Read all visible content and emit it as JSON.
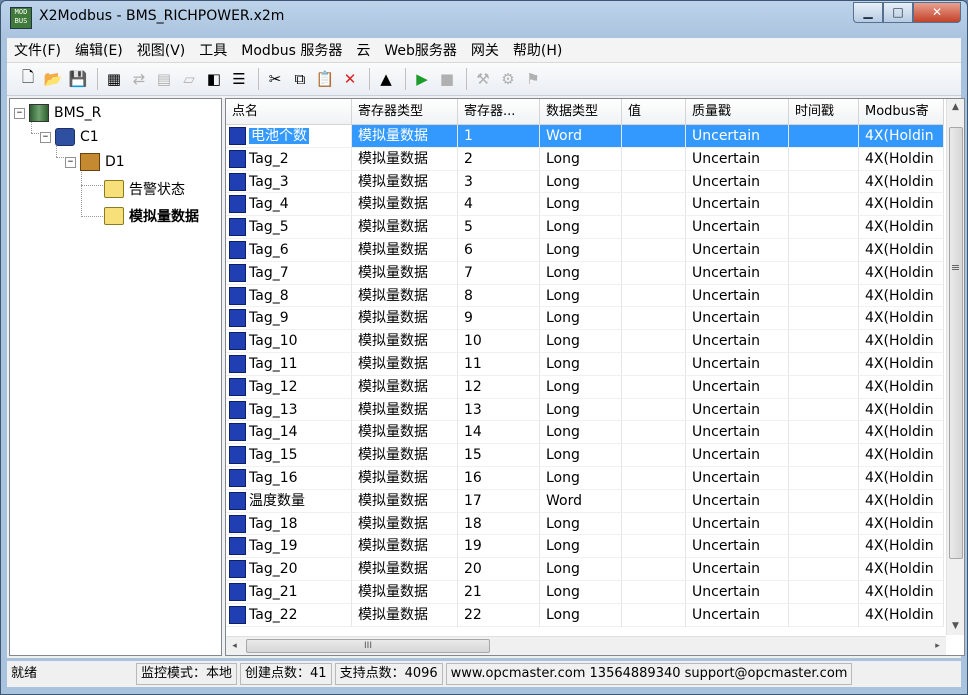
{
  "window": {
    "app_icon": "MOD BUS",
    "title": "X2Modbus - BMS_RICHPOWER.x2m",
    "buttons": {
      "minimize": "▁",
      "maximize": "□",
      "close": "✕"
    }
  },
  "menu": [
    "文件(F)",
    "编辑(E)",
    "视图(V)",
    "工具",
    "Modbus 服务器",
    "云",
    "Web服务器",
    "网关",
    "帮助(H)"
  ],
  "toolbar_icons": [
    {
      "name": "new-icon",
      "glyph": "🗋",
      "enabled": true
    },
    {
      "name": "open-icon",
      "glyph": "📂",
      "enabled": true
    },
    {
      "name": "save-icon",
      "glyph": "💾",
      "enabled": false
    },
    {
      "name": "add-server-icon",
      "glyph": "▦",
      "enabled": true
    },
    {
      "name": "add-channel-icon",
      "glyph": "⇄",
      "enabled": false
    },
    {
      "name": "add-device-icon",
      "glyph": "▤",
      "enabled": false
    },
    {
      "name": "add-group-icon",
      "glyph": "▱",
      "enabled": false
    },
    {
      "name": "add-tag-icon",
      "glyph": "◧",
      "enabled": true
    },
    {
      "name": "properties-icon",
      "glyph": "☰",
      "enabled": true
    },
    {
      "name": "cut-icon",
      "glyph": "✂",
      "enabled": true
    },
    {
      "name": "copy-icon",
      "glyph": "⧉",
      "enabled": true
    },
    {
      "name": "paste-icon",
      "glyph": "📋",
      "enabled": false
    },
    {
      "name": "delete-icon",
      "glyph": "✕",
      "enabled": true
    },
    {
      "name": "monitor-icon",
      "glyph": "▲",
      "enabled": true
    },
    {
      "name": "run-icon",
      "glyph": "▶",
      "enabled": true
    },
    {
      "name": "stop-icon",
      "glyph": "■",
      "enabled": false
    },
    {
      "name": "tool1-icon",
      "glyph": "⚒",
      "enabled": false
    },
    {
      "name": "tool2-icon",
      "glyph": "⚙",
      "enabled": false
    },
    {
      "name": "tool3-icon",
      "glyph": "⚑",
      "enabled": false
    }
  ],
  "tree": {
    "server": "BMS_R",
    "channel": "C1",
    "device": "D1",
    "groups": [
      "告警状态",
      "模拟量数据"
    ],
    "expand_glyph": "−"
  },
  "grid": {
    "columns": [
      "点名",
      "寄存器类型",
      "寄存器...",
      "数据类型",
      "值",
      "质量戳",
      "时间戳",
      "Modbus寄"
    ],
    "rows": [
      {
        "name": "电池个数",
        "reg_type": "模拟量数据",
        "reg": "1",
        "dtype": "Word",
        "value": "",
        "quality": "Uncertain",
        "time": "",
        "modbus": "4X(Holdin"
      },
      {
        "name": "Tag_2",
        "reg_type": "模拟量数据",
        "reg": "2",
        "dtype": "Long",
        "value": "",
        "quality": "Uncertain",
        "time": "",
        "modbus": "4X(Holdin"
      },
      {
        "name": "Tag_3",
        "reg_type": "模拟量数据",
        "reg": "3",
        "dtype": "Long",
        "value": "",
        "quality": "Uncertain",
        "time": "",
        "modbus": "4X(Holdin"
      },
      {
        "name": "Tag_4",
        "reg_type": "模拟量数据",
        "reg": "4",
        "dtype": "Long",
        "value": "",
        "quality": "Uncertain",
        "time": "",
        "modbus": "4X(Holdin"
      },
      {
        "name": "Tag_5",
        "reg_type": "模拟量数据",
        "reg": "5",
        "dtype": "Long",
        "value": "",
        "quality": "Uncertain",
        "time": "",
        "modbus": "4X(Holdin"
      },
      {
        "name": "Tag_6",
        "reg_type": "模拟量数据",
        "reg": "6",
        "dtype": "Long",
        "value": "",
        "quality": "Uncertain",
        "time": "",
        "modbus": "4X(Holdin"
      },
      {
        "name": "Tag_7",
        "reg_type": "模拟量数据",
        "reg": "7",
        "dtype": "Long",
        "value": "",
        "quality": "Uncertain",
        "time": "",
        "modbus": "4X(Holdin"
      },
      {
        "name": "Tag_8",
        "reg_type": "模拟量数据",
        "reg": "8",
        "dtype": "Long",
        "value": "",
        "quality": "Uncertain",
        "time": "",
        "modbus": "4X(Holdin"
      },
      {
        "name": "Tag_9",
        "reg_type": "模拟量数据",
        "reg": "9",
        "dtype": "Long",
        "value": "",
        "quality": "Uncertain",
        "time": "",
        "modbus": "4X(Holdin"
      },
      {
        "name": "Tag_10",
        "reg_type": "模拟量数据",
        "reg": "10",
        "dtype": "Long",
        "value": "",
        "quality": "Uncertain",
        "time": "",
        "modbus": "4X(Holdin"
      },
      {
        "name": "Tag_11",
        "reg_type": "模拟量数据",
        "reg": "11",
        "dtype": "Long",
        "value": "",
        "quality": "Uncertain",
        "time": "",
        "modbus": "4X(Holdin"
      },
      {
        "name": "Tag_12",
        "reg_type": "模拟量数据",
        "reg": "12",
        "dtype": "Long",
        "value": "",
        "quality": "Uncertain",
        "time": "",
        "modbus": "4X(Holdin"
      },
      {
        "name": "Tag_13",
        "reg_type": "模拟量数据",
        "reg": "13",
        "dtype": "Long",
        "value": "",
        "quality": "Uncertain",
        "time": "",
        "modbus": "4X(Holdin"
      },
      {
        "name": "Tag_14",
        "reg_type": "模拟量数据",
        "reg": "14",
        "dtype": "Long",
        "value": "",
        "quality": "Uncertain",
        "time": "",
        "modbus": "4X(Holdin"
      },
      {
        "name": "Tag_15",
        "reg_type": "模拟量数据",
        "reg": "15",
        "dtype": "Long",
        "value": "",
        "quality": "Uncertain",
        "time": "",
        "modbus": "4X(Holdin"
      },
      {
        "name": "Tag_16",
        "reg_type": "模拟量数据",
        "reg": "16",
        "dtype": "Long",
        "value": "",
        "quality": "Uncertain",
        "time": "",
        "modbus": "4X(Holdin"
      },
      {
        "name": "温度数量",
        "reg_type": "模拟量数据",
        "reg": "17",
        "dtype": "Word",
        "value": "",
        "quality": "Uncertain",
        "time": "",
        "modbus": "4X(Holdin"
      },
      {
        "name": "Tag_18",
        "reg_type": "模拟量数据",
        "reg": "18",
        "dtype": "Long",
        "value": "",
        "quality": "Uncertain",
        "time": "",
        "modbus": "4X(Holdin"
      },
      {
        "name": "Tag_19",
        "reg_type": "模拟量数据",
        "reg": "19",
        "dtype": "Long",
        "value": "",
        "quality": "Uncertain",
        "time": "",
        "modbus": "4X(Holdin"
      },
      {
        "name": "Tag_20",
        "reg_type": "模拟量数据",
        "reg": "20",
        "dtype": "Long",
        "value": "",
        "quality": "Uncertain",
        "time": "",
        "modbus": "4X(Holdin"
      },
      {
        "name": "Tag_21",
        "reg_type": "模拟量数据",
        "reg": "21",
        "dtype": "Long",
        "value": "",
        "quality": "Uncertain",
        "time": "",
        "modbus": "4X(Holdin"
      },
      {
        "name": "Tag_22",
        "reg_type": "模拟量数据",
        "reg": "22",
        "dtype": "Long",
        "value": "",
        "quality": "Uncertain",
        "time": "",
        "modbus": "4X(Holdin"
      }
    ],
    "selected_row": 0,
    "scroll_glyphs": {
      "up": "▲",
      "down": "▼",
      "left": "◂",
      "right": "▸",
      "grip": "III",
      "vgrip": "≡"
    }
  },
  "status": {
    "ready": "就绪",
    "mode": "监控模式：本地",
    "created": "创建点数：41",
    "supported": "支持点数：4096",
    "contact": "www.opcmaster.com 13564889340 support@opcmaster.com"
  },
  "colors": {
    "selection": "#3399ff",
    "tag_icon": "#1f3fb3",
    "title_gradient": "#bcd3ea"
  }
}
